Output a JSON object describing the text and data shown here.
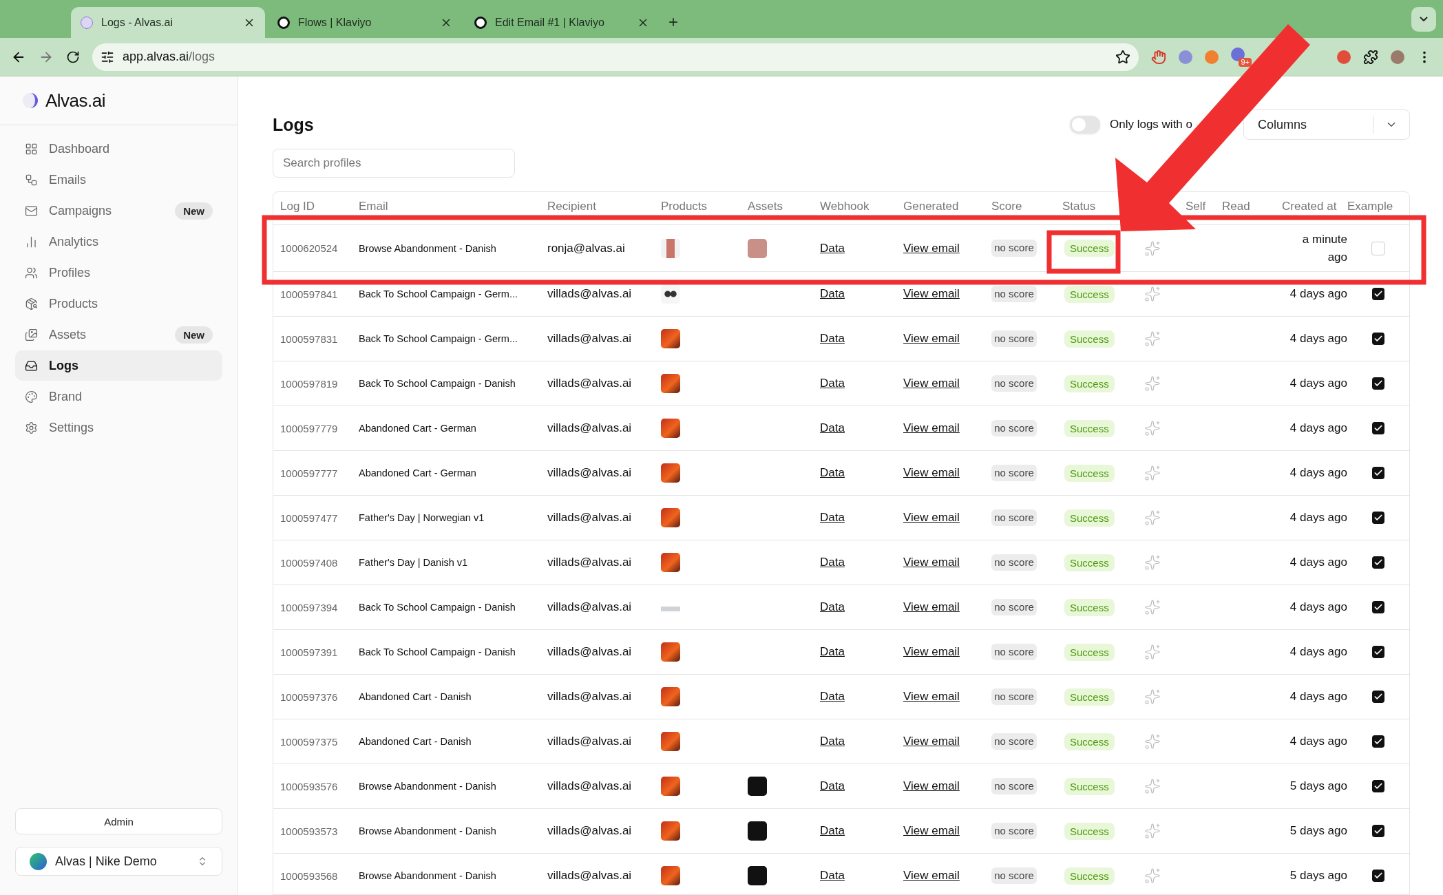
{
  "browser": {
    "tabs": [
      {
        "title": "Logs - Alvas.ai",
        "selected": true
      },
      {
        "title": "Flows | Klaviyo",
        "selected": false
      },
      {
        "title": "Edit Email #1 | Klaviyo",
        "selected": false
      }
    ],
    "new_tab": "+",
    "url_host": "app.alvas.ai",
    "url_path": "/logs",
    "badge": "9+"
  },
  "sidebar": {
    "logo": "Alvas.ai",
    "items": [
      {
        "label": "Dashboard",
        "selected": false
      },
      {
        "label": "Emails",
        "selected": false
      },
      {
        "label": "Campaigns",
        "selected": false,
        "badge": "New"
      },
      {
        "label": "Analytics",
        "selected": false
      },
      {
        "label": "Profiles",
        "selected": false
      },
      {
        "label": "Products",
        "selected": false
      },
      {
        "label": "Assets",
        "selected": false,
        "badge": "New"
      },
      {
        "label": "Logs",
        "selected": true
      },
      {
        "label": "Brand",
        "selected": false
      },
      {
        "label": "Settings",
        "selected": false
      }
    ],
    "admin_button": "Admin",
    "workspace": "Alvas | Nike Demo"
  },
  "page": {
    "title": "Logs",
    "search": {
      "placeholder": "Search profiles"
    },
    "toggle": {
      "label": "Only logs with o",
      "on": false
    },
    "columns_dropdown": "Columns"
  },
  "table": {
    "columns": [
      "Log ID",
      "Email",
      "Recipient",
      "Products",
      "Assets",
      "Webhook",
      "Generated",
      "Score",
      "Status",
      "Self",
      "Read",
      "Created at",
      "Example"
    ],
    "rows": [
      {
        "log_id": "1000620524",
        "email": "Browse Abandonment - Danish",
        "recipient": "ronja@alvas.ai",
        "product": {
          "kind": "model"
        },
        "asset": {
          "kind": "pink"
        },
        "webhook": "Data",
        "generated": "View email",
        "score": "no score",
        "status": "Success",
        "created": "a minute ago",
        "example": false
      },
      {
        "log_id": "1000597841",
        "email": "Back To School Campaign - Germ...",
        "recipient": "villads@alvas.ai",
        "product": {
          "kind": "sunglasses"
        },
        "webhook": "Data",
        "generated": "View email",
        "score": "no score",
        "status": "Success",
        "created": "4 days ago",
        "example": true
      },
      {
        "log_id": "1000597831",
        "email": "Back To School Campaign - Germ...",
        "recipient": "villads@alvas.ai",
        "product": {
          "kind": "orange"
        },
        "webhook": "Data",
        "generated": "View email",
        "score": "no score",
        "status": "Success",
        "created": "4 days ago",
        "example": true
      },
      {
        "log_id": "1000597819",
        "email": "Back To School Campaign - Danish",
        "recipient": "villads@alvas.ai",
        "product": {
          "kind": "orange"
        },
        "webhook": "Data",
        "generated": "View email",
        "score": "no score",
        "status": "Success",
        "created": "4 days ago",
        "example": true
      },
      {
        "log_id": "1000597779",
        "email": "Abandoned Cart - German",
        "recipient": "villads@alvas.ai",
        "product": {
          "kind": "orange"
        },
        "webhook": "Data",
        "generated": "View email",
        "score": "no score",
        "status": "Success",
        "created": "4 days ago",
        "example": true
      },
      {
        "log_id": "1000597777",
        "email": "Abandoned Cart - German",
        "recipient": "villads@alvas.ai",
        "product": {
          "kind": "orange"
        },
        "webhook": "Data",
        "generated": "View email",
        "score": "no score",
        "status": "Success",
        "created": "4 days ago",
        "example": true
      },
      {
        "log_id": "1000597477",
        "email": "Father's Day | Norwegian v1",
        "recipient": "villads@alvas.ai",
        "product": {
          "kind": "orange"
        },
        "webhook": "Data",
        "generated": "View email",
        "score": "no score",
        "status": "Success",
        "created": "4 days ago",
        "example": true
      },
      {
        "log_id": "1000597408",
        "email": "Father's Day | Danish v1",
        "recipient": "villads@alvas.ai",
        "product": {
          "kind": "orange"
        },
        "webhook": "Data",
        "generated": "View email",
        "score": "no score",
        "status": "Success",
        "created": "4 days ago",
        "example": true
      },
      {
        "log_id": "1000597394",
        "email": "Back To School Campaign - Danish",
        "recipient": "villads@alvas.ai",
        "product": {
          "kind": "sneaker"
        },
        "webhook": "Data",
        "generated": "View email",
        "score": "no score",
        "status": "Success",
        "created": "4 days ago",
        "example": true
      },
      {
        "log_id": "1000597391",
        "email": "Back To School Campaign - Danish",
        "recipient": "villads@alvas.ai",
        "product": {
          "kind": "orange"
        },
        "webhook": "Data",
        "generated": "View email",
        "score": "no score",
        "status": "Success",
        "created": "4 days ago",
        "example": true
      },
      {
        "log_id": "1000597376",
        "email": "Abandoned Cart - Danish",
        "recipient": "villads@alvas.ai",
        "product": {
          "kind": "orange"
        },
        "webhook": "Data",
        "generated": "View email",
        "score": "no score",
        "status": "Success",
        "created": "4 days ago",
        "example": true
      },
      {
        "log_id": "1000597375",
        "email": "Abandoned Cart - Danish",
        "recipient": "villads@alvas.ai",
        "product": {
          "kind": "orange"
        },
        "webhook": "Data",
        "generated": "View email",
        "score": "no score",
        "status": "Success",
        "created": "4 days ago",
        "example": true
      },
      {
        "log_id": "1000593576",
        "email": "Browse Abandonment - Danish",
        "recipient": "villads@alvas.ai",
        "product": {
          "kind": "orange"
        },
        "asset": {
          "kind": "black"
        },
        "webhook": "Data",
        "generated": "View email",
        "score": "no score",
        "status": "Success",
        "created": "5 days ago",
        "example": true
      },
      {
        "log_id": "1000593573",
        "email": "Browse Abandonment - Danish",
        "recipient": "villads@alvas.ai",
        "product": {
          "kind": "orange"
        },
        "asset": {
          "kind": "black"
        },
        "webhook": "Data",
        "generated": "View email",
        "score": "no score",
        "status": "Success",
        "created": "5 days ago",
        "example": true
      },
      {
        "log_id": "1000593568",
        "email": "Browse Abandonment - Danish",
        "recipient": "villads@alvas.ai",
        "product": {
          "kind": "orange"
        },
        "asset": {
          "kind": "black"
        },
        "webhook": "Data",
        "generated": "View email",
        "score": "no score",
        "status": "Success",
        "created": "5 days ago",
        "example": true
      }
    ]
  }
}
